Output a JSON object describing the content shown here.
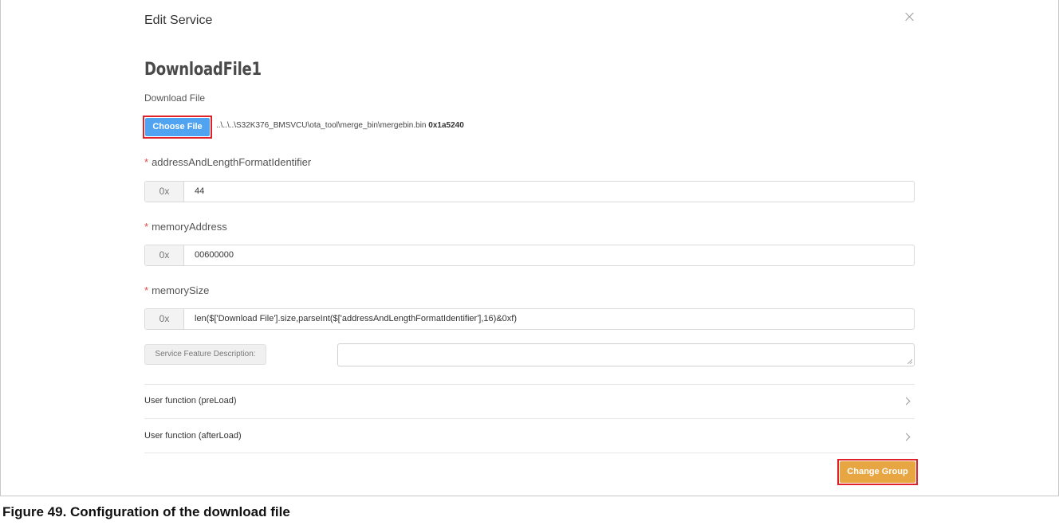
{
  "dialog": {
    "title": "Edit Service",
    "service_name": "DownloadFile1"
  },
  "download": {
    "label": "Download File",
    "choose_button": "Choose File",
    "file_path": "..\\..\\..\\S32K376_BMSVCU\\ota_tool\\merge_bin\\mergebin.bin",
    "file_size": "0x1a5240"
  },
  "fields": {
    "required_mark": "*",
    "alfi": {
      "label": "addressAndLengthFormatIdentifier",
      "prefix": "0x",
      "value": "44"
    },
    "memory_address": {
      "label": "memoryAddress",
      "prefix": "0x",
      "value": "00600000"
    },
    "memory_size": {
      "label": "memorySize",
      "prefix": "0x",
      "value": "len($['Download File'].size,parseInt($['addressAndLengthFormatIdentifier'],16)&0xf)"
    }
  },
  "description": {
    "label": "Service Feature Description:",
    "value": ""
  },
  "user_functions": [
    {
      "label": "User function (preLoad)"
    },
    {
      "label": "User function (afterLoad)"
    }
  ],
  "actions": {
    "change_group": "Change Group"
  },
  "caption": "Figure 49.  Configuration of the download file",
  "colors": {
    "choose_button": "#4fa3f0",
    "change_group_button": "#e8a642",
    "highlight": "#e0212a"
  },
  "icons": {
    "close": "close-icon",
    "chevron": "chevron-right-icon"
  }
}
